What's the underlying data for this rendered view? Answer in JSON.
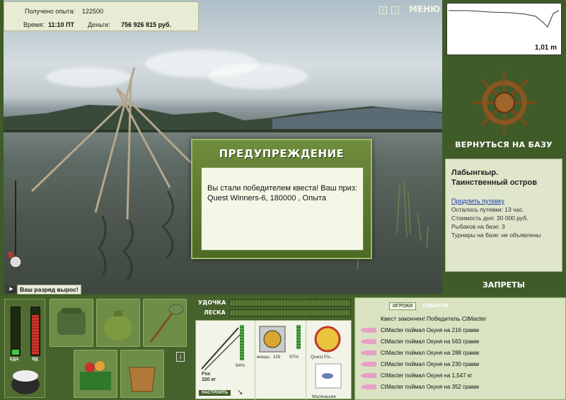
{
  "stats": {
    "exp_label": "Получено опыта:",
    "exp_value": "122500",
    "time_label": "Время:",
    "time_value": "11:10 ПТ",
    "money_label": "Деньги:",
    "money_value": "756 926 815 руб."
  },
  "top_menu": {
    "menu_label": "МЕНЮ",
    "pause_icon": "pause-icon",
    "sound_icon": "sound-icon"
  },
  "depth": {
    "value": "1,01 m"
  },
  "base": {
    "return_label": "ВЕРНУТЬСЯ НА БАЗУ",
    "location_line1": "Лабынгкыр.",
    "location_line2": "Таинственный остров",
    "extend_link": "Продлить путевку",
    "info_lines": [
      "Осталось путевки: 13 час.",
      "Стоимость дня: 30 000 руб.",
      "Рыбаков на базе: 3",
      "Турниры на базе: не объявлены"
    ],
    "bans_label": "ЗАПРЕТЫ"
  },
  "dialog": {
    "title": "ПРЕДУПРЕЖДЕНИЕ",
    "message": "Вы стали победителем квеста! Ваш приз: Quest Winners-6, 180000 , Опыта"
  },
  "rank": {
    "message": "Ваш разряд вырос!"
  },
  "meters": {
    "food_label": "ЕДА",
    "poison_label": "ЯД",
    "food_level": 0.1,
    "poison_level": 0.85
  },
  "tackle": {
    "rod_label": "УДОЧКА",
    "line_label": "ЛЕСКА",
    "rod_name": "Fox",
    "rod_weight": "320 кг",
    "rod_percent": "94%",
    "reel_power": "мощн.: 135",
    "reel_percent": "97%",
    "line_name": "Quest Fis...",
    "lure_name": "Маленькая",
    "setup_button": "НАСТРОИТЬ"
  },
  "events": {
    "tab_players": "ИГРОКИ",
    "tab_events": "СОБЫТИЯ",
    "header": "Квест закончен! Победитель CtMacter",
    "rows": [
      "CtMacter поймал Окуня на 216 грамм",
      "CtMacter поймал Окуня на 563 грамм",
      "CtMacter поймал Окуня на 288 грамм",
      "CtMacter поймал Окуня на 230 грамм",
      "CtMacter поймал Окуня на 1,547 кг",
      "CtMacter поймал Окуня на 352 грамм"
    ]
  },
  "colors": {
    "panel_green": "#3f5b28",
    "accent_light": "#e9ecd4",
    "food_green": "#49c44a",
    "poison_red": "#d0342c"
  }
}
